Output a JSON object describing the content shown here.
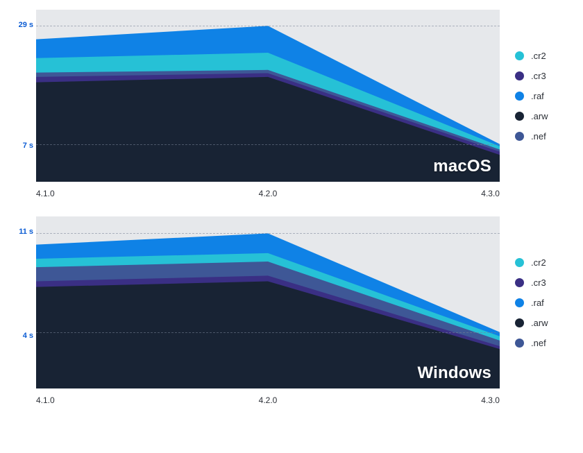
{
  "colors": {
    "cr2": "#26c1d6",
    "cr3": "#3a2f84",
    "raf": "#0f82e6",
    "arw": "#182334",
    "nef": "#3e5796",
    "grid_bg": "#e6e8eb",
    "accent": "#0a5bd3"
  },
  "legend": [
    {
      "key": "cr2",
      "label": ".cr2"
    },
    {
      "key": "cr3",
      "label": ".cr3"
    },
    {
      "key": "raf",
      "label": ".raf"
    },
    {
      "key": "arw",
      "label": ".arw"
    },
    {
      "key": "nef",
      "label": ".nef"
    }
  ],
  "xticks": [
    "4.1.0",
    "4.2.0",
    "4.3.0"
  ],
  "chart_data": [
    {
      "type": "area",
      "title": "macOS",
      "xlabel": "",
      "ylabel": "",
      "ylim": [
        0,
        32
      ],
      "yticks": [
        {
          "value": 29,
          "label": "29 s"
        },
        {
          "value": 7,
          "label": "7 s"
        }
      ],
      "categories": [
        "4.1.0",
        "4.2.0",
        "4.3.0"
      ],
      "series": [
        {
          "name": ".arw",
          "color_key": "arw",
          "values": [
            18.5,
            19.5,
            5.0
          ]
        },
        {
          "name": ".cr3",
          "color_key": "cr3",
          "values": [
            19.5,
            20.2,
            5.6
          ]
        },
        {
          "name": ".nef",
          "color_key": "nef",
          "values": [
            20.3,
            20.8,
            6.0
          ]
        },
        {
          "name": ".cr2",
          "color_key": "cr2",
          "values": [
            23.0,
            24.0,
            6.6
          ]
        },
        {
          "name": ".raf",
          "color_key": "raf",
          "values": [
            26.5,
            29.0,
            7.0
          ]
        }
      ]
    },
    {
      "type": "area",
      "title": "Windows",
      "xlabel": "",
      "ylabel": "",
      "ylim": [
        0,
        12.2
      ],
      "yticks": [
        {
          "value": 11,
          "label": "11 s"
        },
        {
          "value": 4,
          "label": "4 s"
        }
      ],
      "categories": [
        "4.1.0",
        "4.2.0",
        "4.3.0"
      ],
      "series": [
        {
          "name": ".arw",
          "color_key": "arw",
          "values": [
            7.2,
            7.6,
            2.8
          ]
        },
        {
          "name": ".cr3",
          "color_key": "cr3",
          "values": [
            7.6,
            8.0,
            3.0
          ]
        },
        {
          "name": ".nef",
          "color_key": "nef",
          "values": [
            8.6,
            9.0,
            3.4
          ]
        },
        {
          "name": ".cr2",
          "color_key": "cr2",
          "values": [
            9.2,
            9.6,
            3.7
          ]
        },
        {
          "name": ".raf",
          "color_key": "raf",
          "values": [
            10.2,
            11.0,
            4.0
          ]
        }
      ]
    }
  ]
}
